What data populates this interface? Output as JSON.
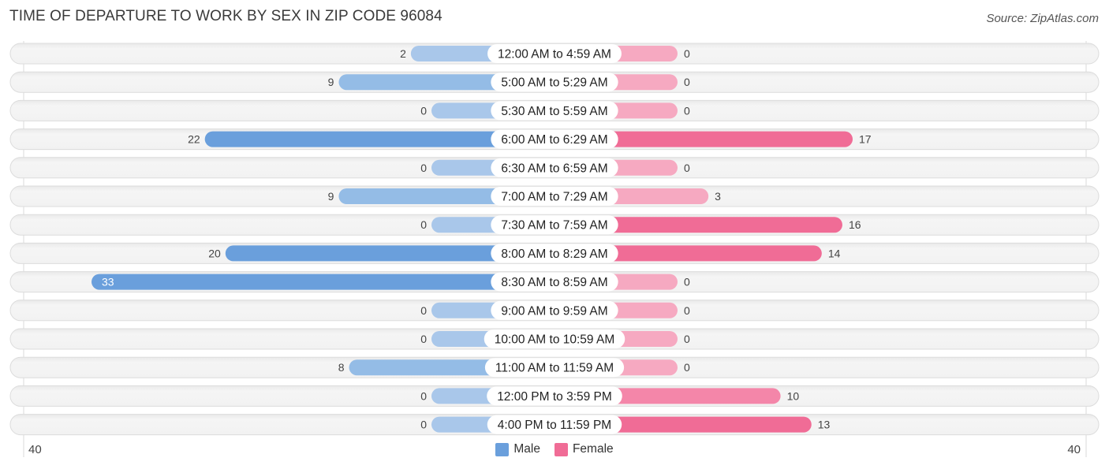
{
  "title": "TIME OF DEPARTURE TO WORK BY SEX IN ZIP CODE 96084",
  "source": "Source: ZipAtlas.com",
  "colors": {
    "male_strong": "#6a9fdc",
    "male_light": "#a9c7ea",
    "female_strong": "#f06c96",
    "female_light": "#f6a9c1",
    "row_bg": "#f3f3f3",
    "row_border": "#dcdcdc"
  },
  "chart_data": {
    "type": "bar",
    "orientation": "horizontal-diverging",
    "title": "TIME OF DEPARTURE TO WORK BY SEX IN ZIP CODE 96084",
    "categories": [
      "12:00 AM to 4:59 AM",
      "5:00 AM to 5:29 AM",
      "5:30 AM to 5:59 AM",
      "6:00 AM to 6:29 AM",
      "6:30 AM to 6:59 AM",
      "7:00 AM to 7:29 AM",
      "7:30 AM to 7:59 AM",
      "8:00 AM to 8:29 AM",
      "8:30 AM to 8:59 AM",
      "9:00 AM to 9:59 AM",
      "10:00 AM to 10:59 AM",
      "11:00 AM to 11:59 AM",
      "12:00 PM to 3:59 PM",
      "4:00 PM to 11:59 PM"
    ],
    "series": [
      {
        "name": "Male",
        "values": [
          2,
          9,
          0,
          22,
          0,
          9,
          0,
          20,
          33,
          0,
          0,
          8,
          0,
          0
        ]
      },
      {
        "name": "Female",
        "values": [
          0,
          0,
          0,
          17,
          0,
          3,
          16,
          14,
          0,
          0,
          0,
          0,
          10,
          13
        ]
      }
    ],
    "xlim": [
      40,
      40
    ],
    "axis_tick_left": "40",
    "axis_tick_right": "40",
    "legend": [
      "Male",
      "Female"
    ],
    "legend_position": "bottom-center",
    "grid": false
  }
}
